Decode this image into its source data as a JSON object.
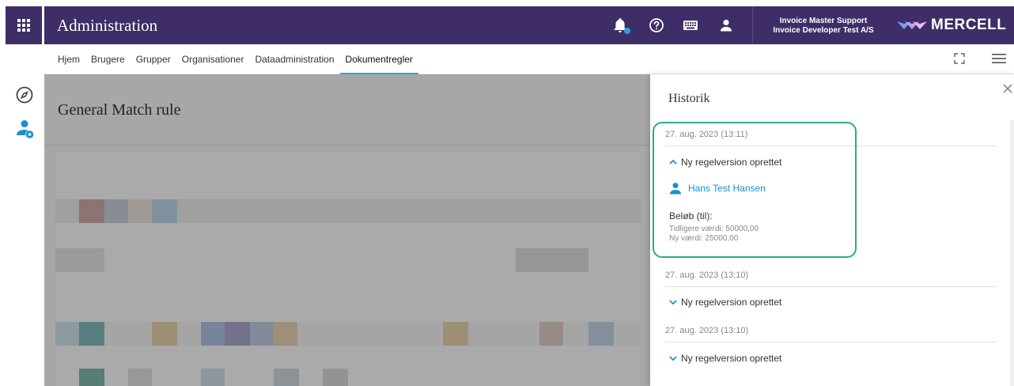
{
  "header": {
    "title": "Administration",
    "user_name": "Invoice Master Support",
    "user_org": "Invoice Developer Test A/S",
    "logo_text": "MERCELL",
    "bg_color": "#3e2d66",
    "icons": [
      "apps-grid-icon",
      "bell-icon",
      "help-icon",
      "keyboard-icon",
      "user-icon",
      "mercell-logo-icon"
    ]
  },
  "nav": {
    "tabs": [
      {
        "label": "Hjem"
      },
      {
        "label": "Brugere"
      },
      {
        "label": "Grupper"
      },
      {
        "label": "Organisationer"
      },
      {
        "label": "Dataadministration"
      },
      {
        "label": "Dokumentregler"
      }
    ],
    "active_tab": "Dokumentregler"
  },
  "main": {
    "title": "General Match rule"
  },
  "history": {
    "title": "Historik",
    "entries": [
      {
        "date": "27. aug. 2023 (13:11)",
        "action": "Ny regelversion oprettet",
        "expanded": true,
        "user": "Hans Test Hansen",
        "field": "Beløb (til):",
        "old_value": "Tidligere værdi: 50000,00",
        "new_value": "Ny værdi: 25000,00"
      },
      {
        "date": "27. aug. 2023 (13:10)",
        "action": "Ny regelversion oprettet",
        "expanded": false
      },
      {
        "date": "27. aug. 2023 (13:10)",
        "action": "Ny regelversion oprettet",
        "expanded": false
      }
    ],
    "accent_color": "#1d8fcf",
    "highlight_color": "#2aab8e"
  }
}
